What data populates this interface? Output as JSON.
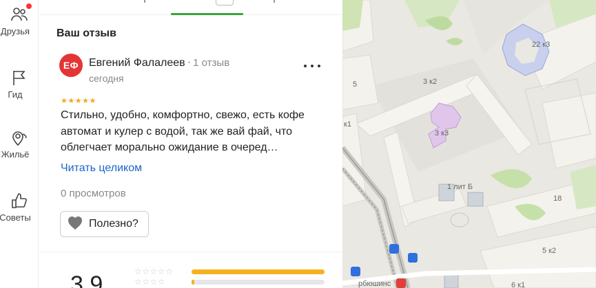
{
  "rail": {
    "items": [
      {
        "label": "Друзья",
        "icon": "people-icon"
      },
      {
        "label": "Гид",
        "icon": "flag-icon"
      },
      {
        "label": "Жильё",
        "icon": "house-icon"
      },
      {
        "label": "Советы",
        "icon": "thumbs-up-icon"
      }
    ]
  },
  "review": {
    "section_title": "Ваш отзыв",
    "avatar_initials": "ЕФ",
    "author": "Евгений Фалалеев",
    "author_review_count": "1 отзыв",
    "date": "сегодня",
    "rating": 5,
    "text": "Стильно, удобно, комфортно, свежо, есть кофе автомат и кулер с водой, так же вай фай, что облегчает морально ожидание в очеред…",
    "read_more": "Читать целиком",
    "views": "0 просмотров",
    "helpful_label": "Полезно?"
  },
  "summary": {
    "rating": "3.9",
    "distribution": [
      {
        "stars": 5,
        "fraction": 1.0
      },
      {
        "stars": 4,
        "fraction": 0.02
      }
    ]
  },
  "map": {
    "labels": [
      "22 к3",
      "3 к2",
      "5",
      "3 к3",
      "1 лит Б",
      "к1",
      "18",
      "5 к2",
      "6 к1",
      "рбюшинс"
    ]
  },
  "colors": {
    "accent_green": "#3aa339",
    "link_blue": "#1a66c9",
    "star_orange": "#f5a623",
    "avatar_red": "#e43535"
  }
}
